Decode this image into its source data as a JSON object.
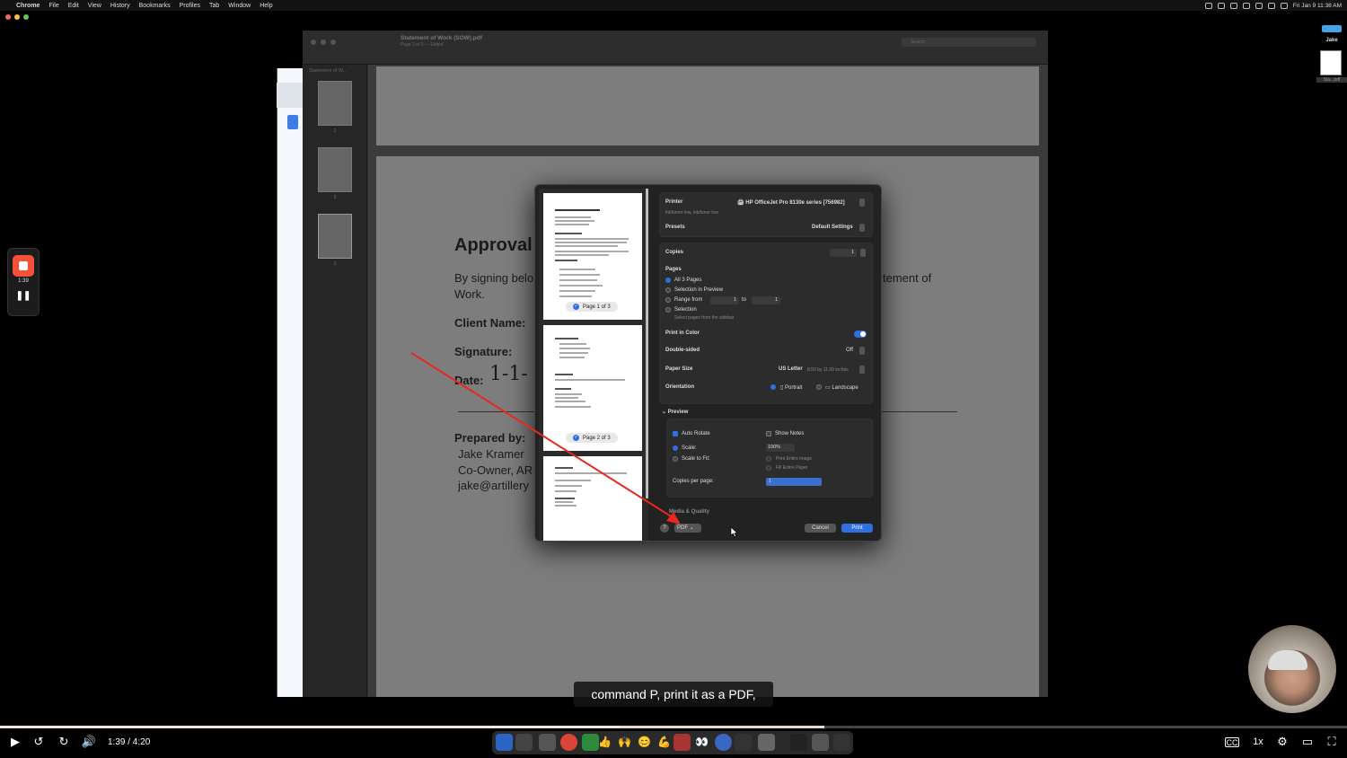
{
  "menubar": {
    "apple": "",
    "items": [
      "Chrome",
      "File",
      "Edit",
      "View",
      "History",
      "Bookmarks",
      "Profiles",
      "Tab",
      "Window",
      "Help"
    ],
    "clock": "Fri Jan 9  11:38 AM"
  },
  "right_panel": {
    "name": "Jake",
    "file_caption": "Sta...pdf"
  },
  "recorder": {
    "time": "1:39",
    "pause": "❚❚"
  },
  "preview": {
    "title": "Statement of Work (SOW).pdf",
    "subtitle": "Page 3 of 3 — Edited",
    "search_placeholder": "Search",
    "sidebar_title": "Statement of W...",
    "thumb_numbers": [
      "1",
      "2",
      "3"
    ]
  },
  "document": {
    "approval": "Approval",
    "sign_text_a": "By signing belo",
    "sign_text_b": "Work.",
    "sign_text_c": "tement of",
    "client": "Client Name:",
    "signature": "Signature:",
    "date": "Date:",
    "date_hand": "1-1-",
    "prepared_by": "Prepared by:",
    "name": "Jake Kramer",
    "role": "Co-Owner, AR",
    "email": "jake@artillery"
  },
  "print_dialog": {
    "page_labels": [
      "Page 1 of 3",
      "Page 2 of 3"
    ],
    "printer_label": "Printer",
    "printer_value": "HP OfficeJet Pro 8130e series [756982]",
    "printer_status": "Ink/toner low, ink/toner low",
    "presets_label": "Presets",
    "presets_value": "Default Settings",
    "copies_label": "Copies",
    "copies_value": "1",
    "pages_label": "Pages",
    "all_pages": "All 3 Pages",
    "selection_preview": "Selection in Preview",
    "range_from": "Range from",
    "range_from_value": "1",
    "range_to": "to",
    "range_to_value": "1",
    "selection": "Selection",
    "selection_hint": "Select pages from the sidebar",
    "color_label": "Print in Color",
    "double_sided_label": "Double-sided",
    "double_sided_value": "Off",
    "paper_size_label": "Paper Size",
    "paper_size_value": "US Letter",
    "paper_size_dims": "8.50 by 11.00 inches",
    "orientation_label": "Orientation",
    "portrait": "Portrait",
    "landscape": "Landscape",
    "preview_section": "Preview",
    "auto_rotate": "Auto Rotate",
    "show_notes": "Show Notes",
    "scale": "Scale:",
    "scale_value": "100%",
    "scale_to_fit": "Scale to Fit:",
    "print_entire_image": "Print Entire Image",
    "fill_entire_paper": "Fill Entire Paper",
    "copies_per_page": "Copies per page:",
    "copies_per_page_value": "1",
    "media_quality": "Media & Quality",
    "help": "?",
    "pdf": "PDF",
    "cancel": "Cancel",
    "print": "Print"
  },
  "caption": "command P, print it as a PDF,",
  "player": {
    "timecode": "1:39 / 4:20",
    "progress": 0.46,
    "buffered": 0.612,
    "speed": "1x",
    "cc": "CC"
  },
  "colors": {
    "accent": "#2f6fe0",
    "record": "#f4503a",
    "arrow": "#e8281e"
  }
}
